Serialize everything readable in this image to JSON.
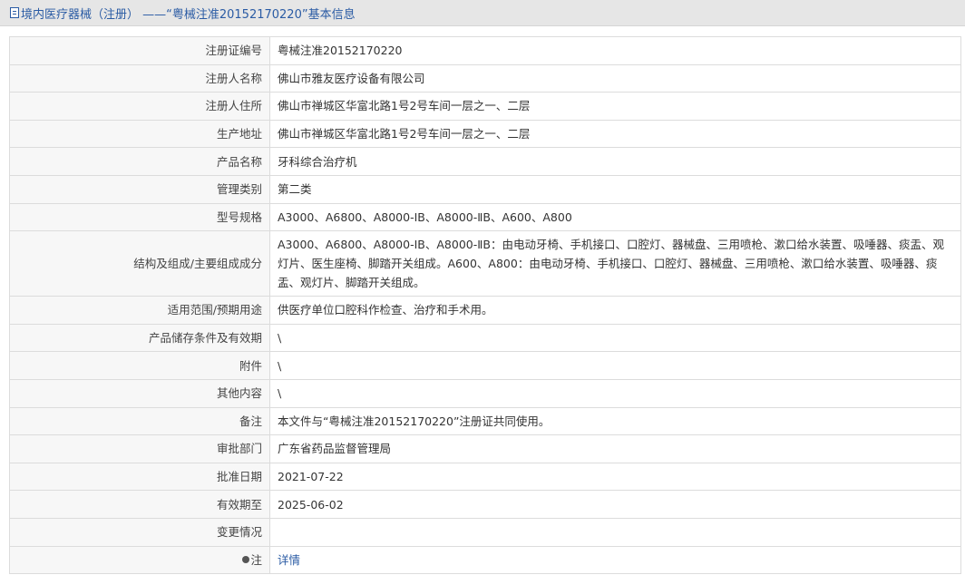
{
  "header": {
    "title": "境内医疗器械（注册） ——“粤械注准20152170220”基本信息"
  },
  "colors": {
    "accent": "#2a5ba4",
    "header_bg": "#e6e6e6",
    "label_bg": "#f7f7f7"
  },
  "rows": [
    {
      "label": "注册证编号",
      "value": "粤械注准20152170220"
    },
    {
      "label": "注册人名称",
      "value": "佛山市雅友医疗设备有限公司"
    },
    {
      "label": "注册人住所",
      "value": "佛山市禅城区华富北路1号2号车间一层之一、二层"
    },
    {
      "label": "生产地址",
      "value": "佛山市禅城区华富北路1号2号车间一层之一、二层"
    },
    {
      "label": "产品名称",
      "value": "牙科综合治疗机"
    },
    {
      "label": "管理类别",
      "value": "第二类"
    },
    {
      "label": "型号规格",
      "value": "A3000、A6800、A8000-IB、A8000-ⅡB、A600、A800"
    },
    {
      "label": "结构及组成/主要组成成分",
      "value": "A3000、A6800、A8000-ⅠB、A8000-ⅡB：由电动牙椅、手机接口、口腔灯、器械盘、三用喷枪、漱口给水装置、吸唾器、痰盂、观灯片、医生座椅、脚踏开关组成。A600、A800：由电动牙椅、手机接口、口腔灯、器械盘、三用喷枪、漱口给水装置、吸唾器、痰盂、观灯片、脚踏开关组成。"
    },
    {
      "label": "适用范围/预期用途",
      "value": "供医疗单位口腔科作检查、治疗和手术用。"
    },
    {
      "label": "产品储存条件及有效期",
      "value": "\\"
    },
    {
      "label": "附件",
      "value": "\\"
    },
    {
      "label": "其他内容",
      "value": "\\"
    },
    {
      "label": "备注",
      "value": "本文件与“粤械注准20152170220”注册证共同使用。"
    },
    {
      "label": "审批部门",
      "value": "广东省药品监督管理局"
    },
    {
      "label": "批准日期",
      "value": "2021-07-22"
    },
    {
      "label": "有效期至",
      "value": "2025-06-02"
    },
    {
      "label": "变更情况",
      "value": ""
    }
  ],
  "note": {
    "label": "注",
    "link_text": "详情",
    "icon": "lightbulb-icon"
  }
}
